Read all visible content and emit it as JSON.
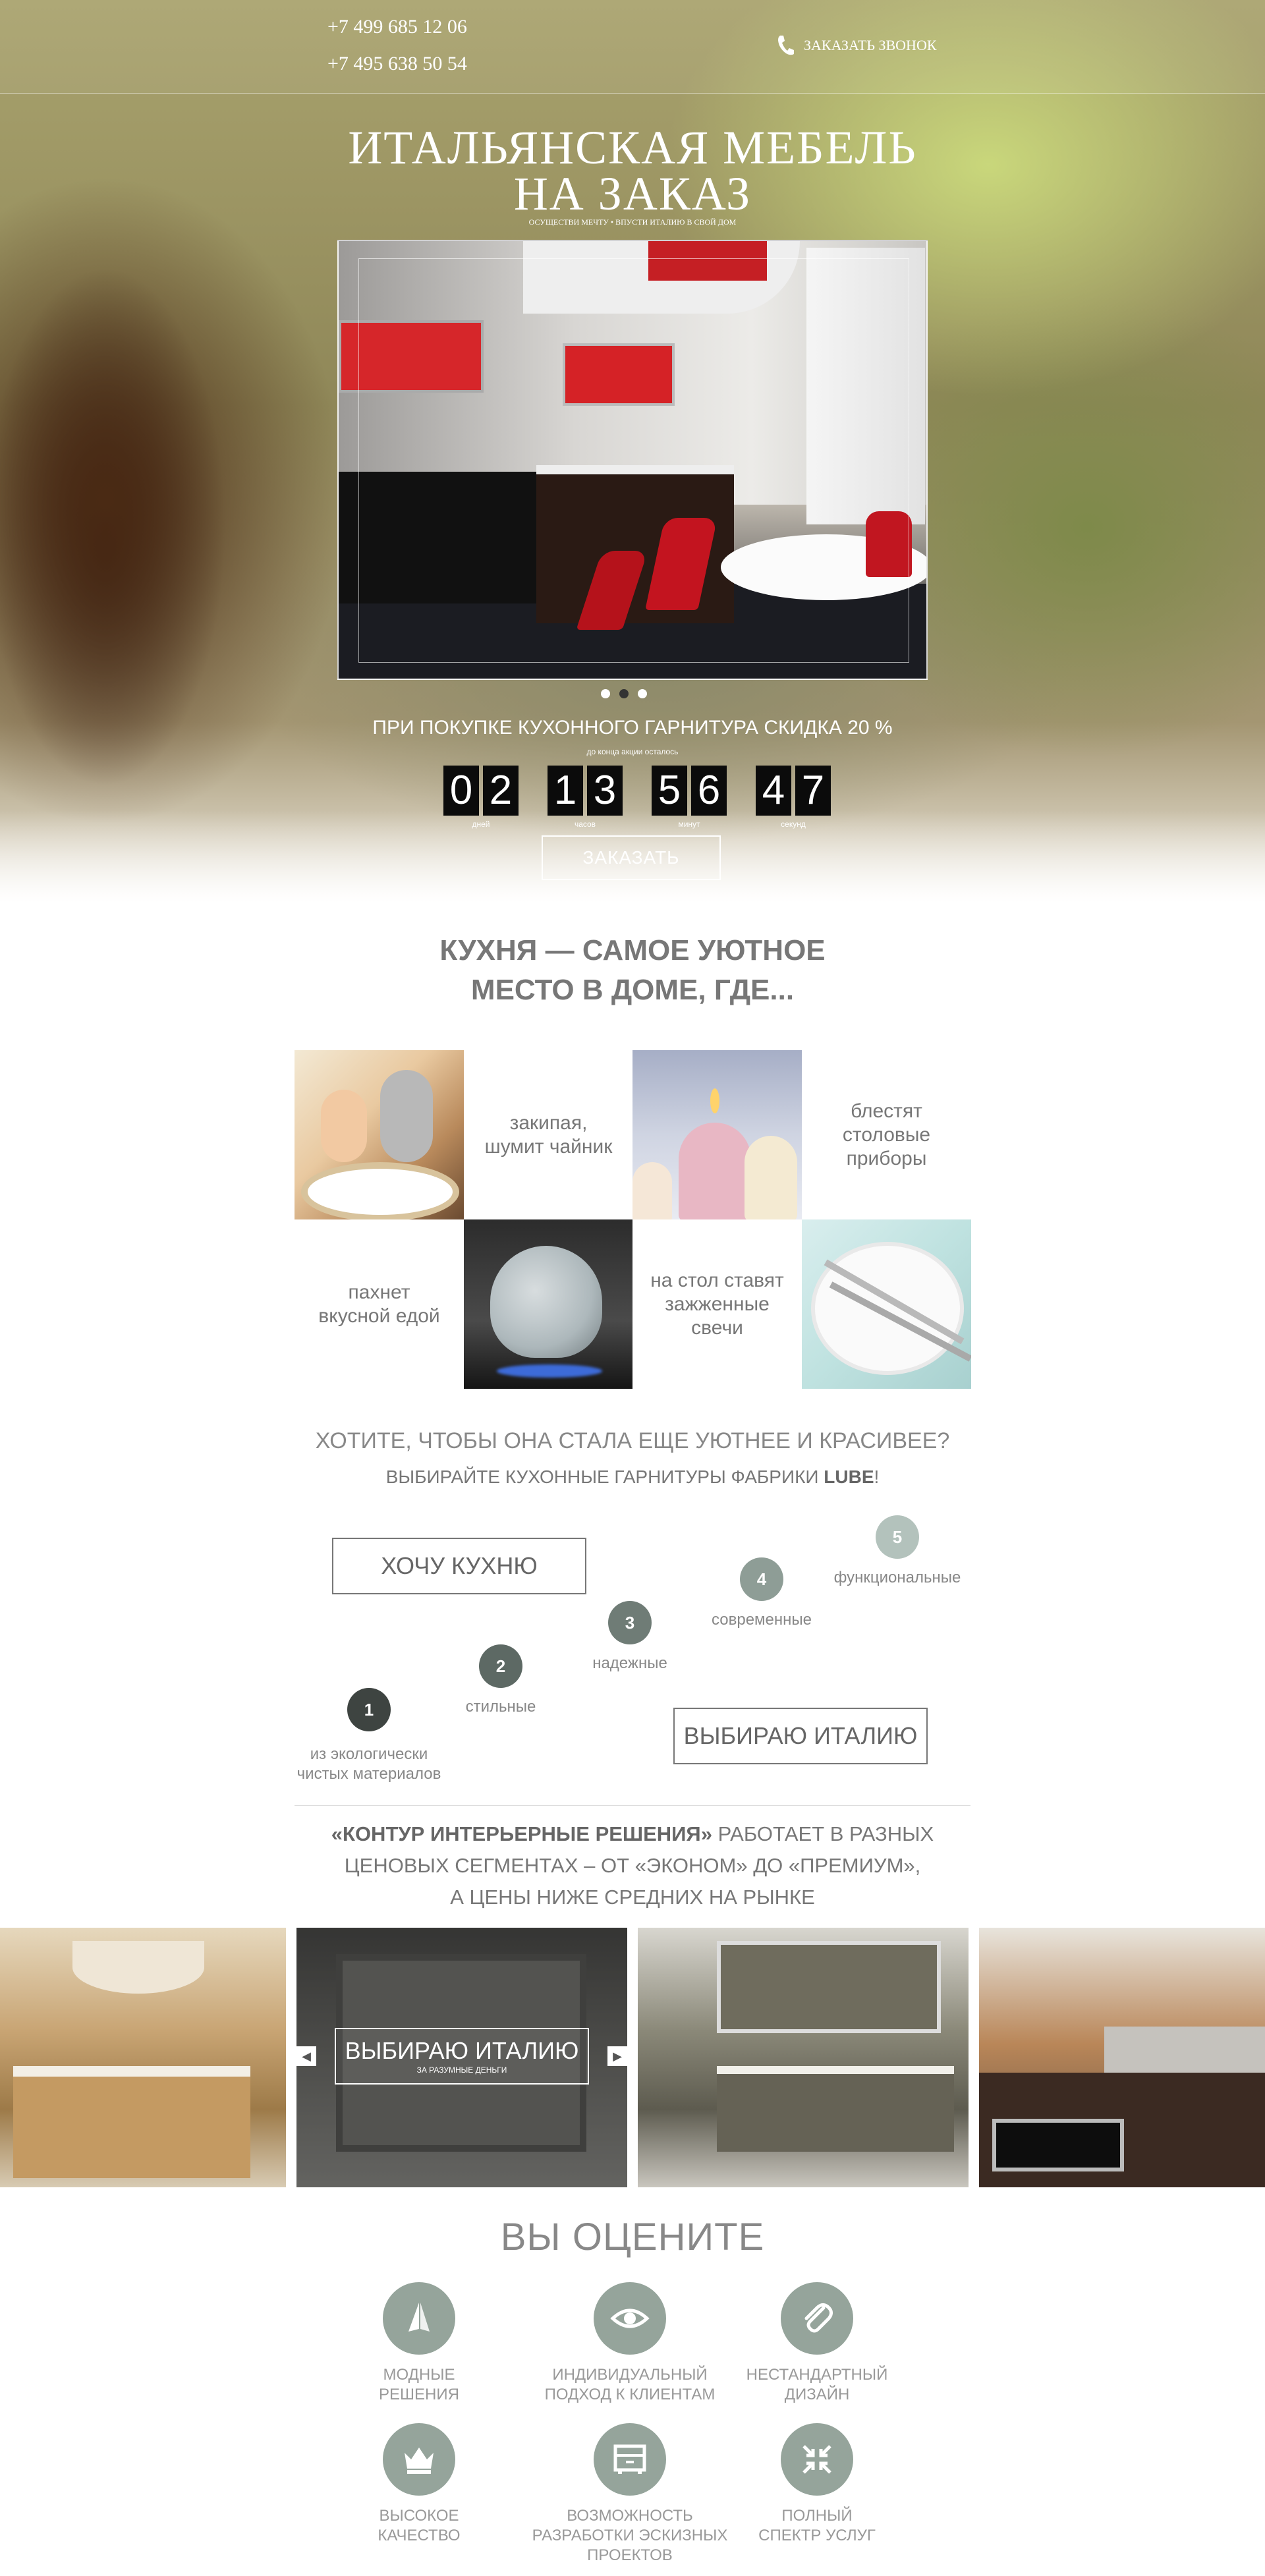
{
  "header": {
    "phone1": "+7 499 685 12 06",
    "phone2": "+7 495 638 50 54",
    "callback_label": "ЗАКАЗАТЬ ЗВОНОК"
  },
  "hero": {
    "title_line1": "ИТАЛЬЯНСКАЯ МЕБЕЛЬ",
    "title_line2": "НА ЗАКАЗ",
    "subtitle": "ОСУЩЕСТВИ МЕЧТУ • ВПУСТИ ИТАЛИЮ В СВОЙ ДОМ",
    "promo": "ПРИ ПОКУПКЕ  КУХОННОГО ГАРНИТУРА СКИДКА 20 %",
    "promo_small": "до конца акции осталось",
    "countdown": [
      {
        "d1": "0",
        "d2": "2",
        "label": "дней"
      },
      {
        "d1": "1",
        "d2": "3",
        "label": "часов"
      },
      {
        "d1": "5",
        "d2": "6",
        "label": "минут"
      },
      {
        "d1": "4",
        "d2": "7",
        "label": "секунд"
      }
    ],
    "order_button": "ЗАКАЗАТЬ"
  },
  "kitchen_section": {
    "title_line1": "КУХНЯ — САМОЕ УЮТНОЕ",
    "title_line2": "МЕСТО В ДОМЕ, ГДЕ...",
    "tiles": {
      "kettle_text": "закипая,\nшумит чайник",
      "cutlery_text": "блестят\nстоловые\nприборы",
      "food_text": "пахнет\nвкусной едой",
      "candles_text": "на стол ставят\nзажженные\nсвечи"
    },
    "question": "ХОТИТЕ, ЧТОБЫ ОНА СТАЛА ЕЩЕ УЮТНЕЕ И КРАСИВЕЕ?",
    "choose_prefix": "ВЫБИРАЙТЕ КУХОННЫЕ ГАРНИТУРЫ ФАБРИКИ ",
    "choose_brand": "LUBE",
    "choose_suffix": "!",
    "want_button": "ХОЧУ КУХНЮ",
    "italy_button": "ВЫБИРАЮ ИТАЛИЮ",
    "steps": [
      {
        "num": "1",
        "label": "из экологически\nчистых материалов",
        "color": "#3e4441"
      },
      {
        "num": "2",
        "label": "стильные",
        "color": "#5d6964"
      },
      {
        "num": "3",
        "label": "надежные",
        "color": "#6f7c76"
      },
      {
        "num": "4",
        "label": "современные",
        "color": "#8e9d96"
      },
      {
        "num": "5",
        "label": "функциональные",
        "color": "#b3c2bc"
      }
    ],
    "contour_line1_bold": "«КОНТУР ИНТЕРЬЕРНЫЕ РЕШЕНИЯ»",
    "contour_line1_rest": " РАБОТАЕТ В РАЗНЫХ",
    "contour_line2": "ЦЕНОВЫХ СЕГМЕНТАХ – ОТ «ЭКОНОМ» ДО «ПРЕМИУМ»,",
    "contour_line3": "А ЦЕНЫ НИЖЕ СРЕДНИХ НА РЫНКЕ"
  },
  "gallery": {
    "button_big": "ВЫБИРАЮ ИТАЛИЮ",
    "button_small": "ЗА РАЗУМНЫЕ ДЕНЬГИ",
    "prev": "◀",
    "next": "▶"
  },
  "features": {
    "title": "ВЫ ОЦЕНИТЕ",
    "items": [
      {
        "label": "МОДНЫЕ\nРЕШЕНИЯ",
        "icon": "sail-icon"
      },
      {
        "label": "ИНДИВИДУАЛЬНЫЙ\nПОДХОД К КЛИЕНТАМ",
        "icon": "eye-icon"
      },
      {
        "label": "НЕСТАНДАРТНЫЙ\nДИЗАЙН",
        "icon": "paperclip-icon"
      },
      {
        "label": "ВЫСОКОЕ\nКАЧЕСТВО",
        "icon": "crown-icon"
      },
      {
        "label": "ВОЗМОЖНОСТЬ\nРАЗРАБОТКИ ЭСКИЗНЫХ\nПРОЕКТОВ",
        "icon": "drawer-icon"
      },
      {
        "label": "ПОЛНЫЙ\nСПЕКТР УСЛУГ",
        "icon": "compress-icon"
      }
    ]
  },
  "colors": {
    "accent_gray_green": "#95a49b",
    "text_gray": "#777777"
  }
}
